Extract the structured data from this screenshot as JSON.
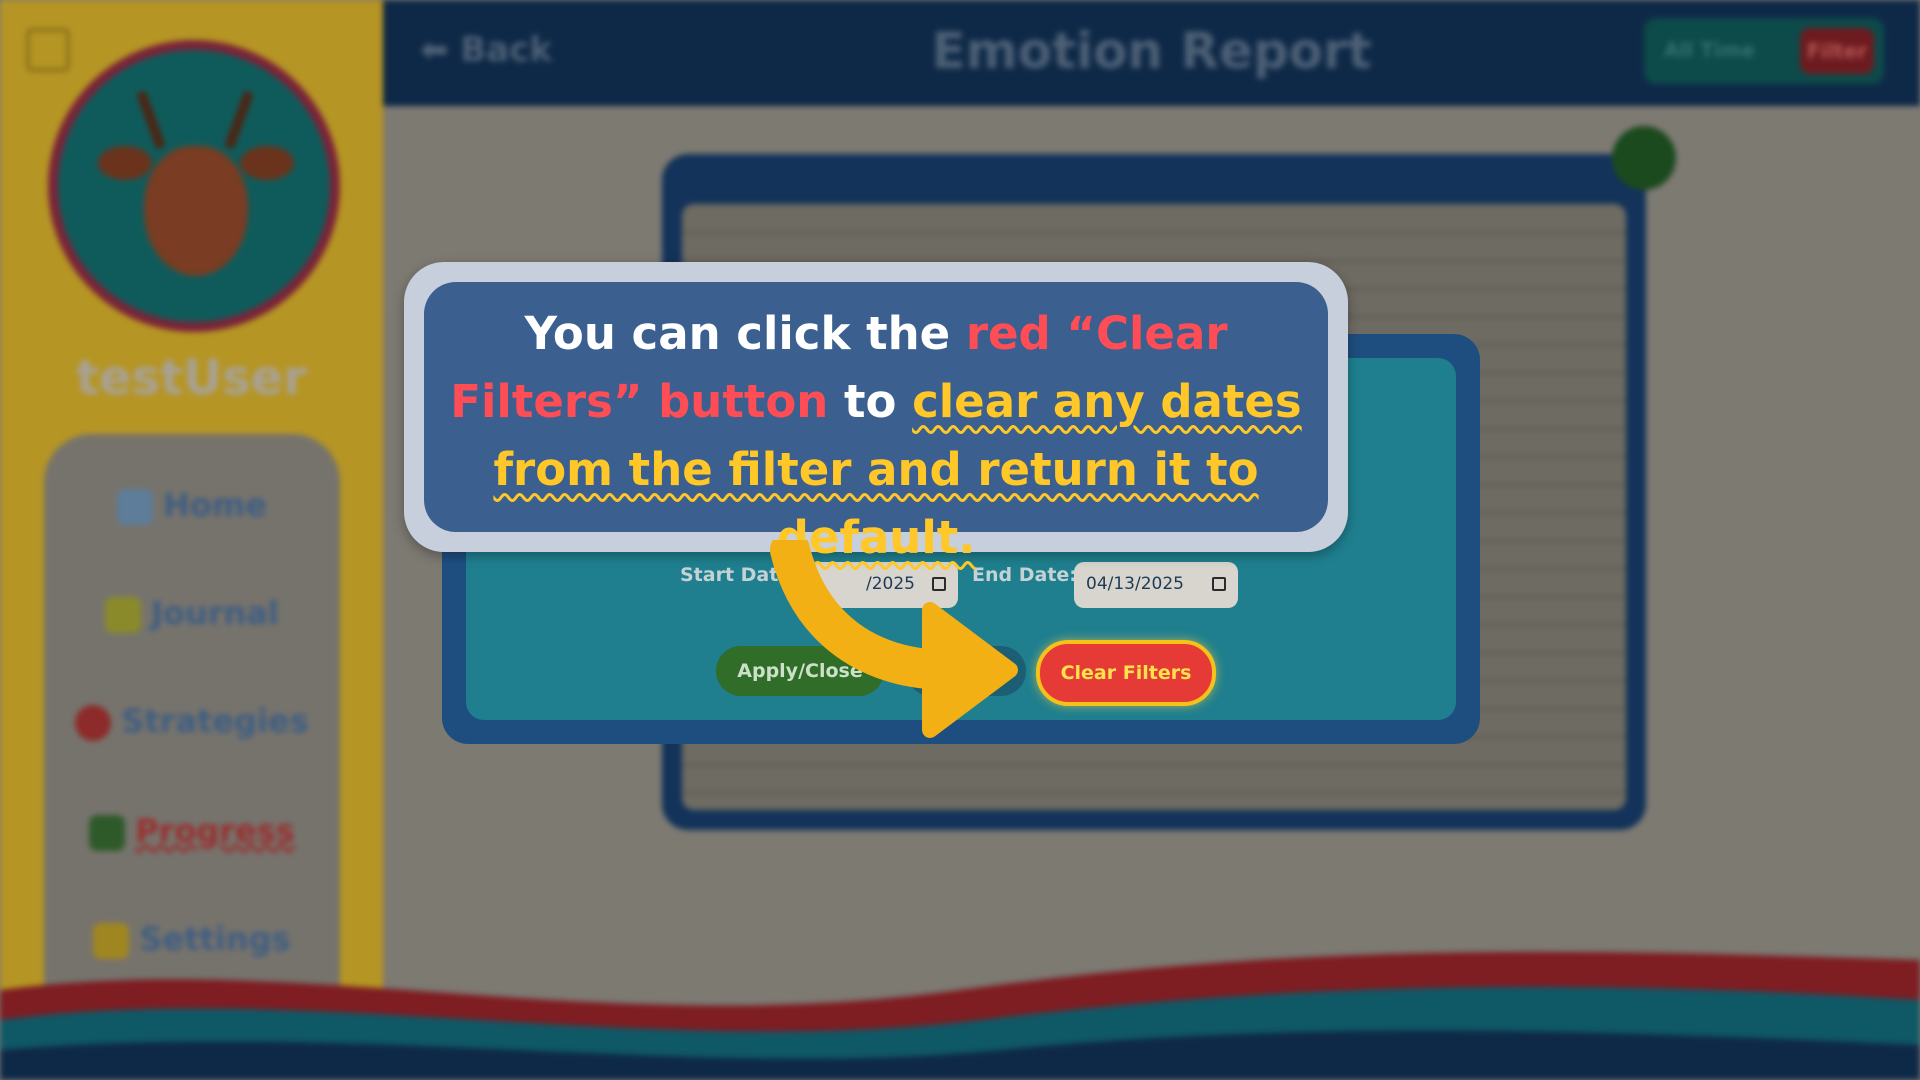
{
  "sidebar": {
    "username": "testUser",
    "nav": [
      {
        "label": "Home",
        "icon": "home-icon"
      },
      {
        "label": "Journal",
        "icon": "pencil-icon"
      },
      {
        "label": "Strategies",
        "icon": "lightbulb-icon"
      },
      {
        "label": "Progress",
        "icon": "chart-icon"
      },
      {
        "label": "Settings",
        "icon": "gear-icon"
      }
    ]
  },
  "header": {
    "back_label": "Back",
    "title": "Emotion Report",
    "range_all": "All Time",
    "range_filter": "Filter"
  },
  "filter": {
    "start_label": "Start Date:",
    "start_value": "/2025",
    "end_label": "End Date:",
    "end_value": "04/13/2025",
    "apply_label": "Apply/Close",
    "clear_label": "Clear Filters"
  },
  "tooltip": {
    "part1": "You can click the ",
    "part2": "red “Clear Filters” button",
    "part3": " to ",
    "part4": "clear any dates from the filter and return it to default."
  },
  "colors": {
    "header": "#0e2947",
    "sidebar": "#b59524",
    "tooltip_bg": "#3b5f8f",
    "highlight_red": "#ff4d55",
    "highlight_yellow": "#ffc727",
    "clear_button": "#e63a36"
  }
}
